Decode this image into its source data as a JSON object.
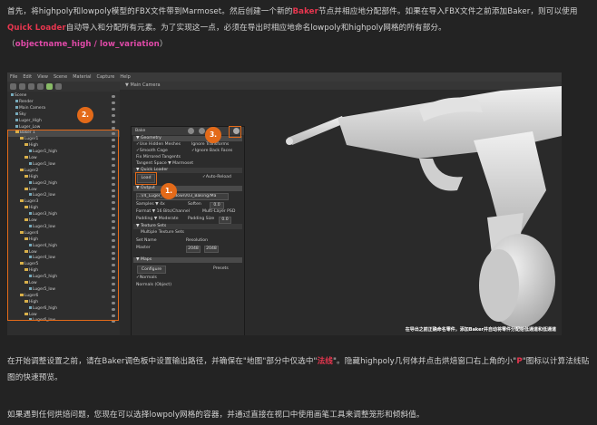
{
  "para1": {
    "t1": "首先，将highpoly和lowpoly模型的FBX文件带到Marmoset。然后创建一个新的",
    "baker": "Baker",
    "t2": "节点并相应地分配部件。如果在导入FBX文件之前添加Baker，则可以使用",
    "quick_loader": "Quick Loader",
    "t3": "自动导入和分配所有元素。为了实现这一点，必须在导出时相应地命名lowpoly和highpoly网格的所有部分。",
    "paren_open": "（",
    "naming": "objectname_high / low_variation",
    "paren_close": "）"
  },
  "screenshot": {
    "menu": [
      "File",
      "Edit",
      "View",
      "Scene",
      "Material",
      "Capture",
      "Help"
    ],
    "viewport_title": "Main Camera",
    "caption": "在导出之前正确命名零件，添加Baker并自动将零件分配给低通道和低通道",
    "badges": [
      "1.",
      "2.",
      "3."
    ],
    "tree": [
      {
        "label": "Scene",
        "indent": 0,
        "kind": "root"
      },
      {
        "label": "Render",
        "indent": 1,
        "kind": "obj"
      },
      {
        "label": "Main Camera",
        "indent": 1,
        "kind": "obj"
      },
      {
        "label": "Sky",
        "indent": 1,
        "kind": "obj"
      },
      {
        "label": "Luger_High",
        "indent": 1,
        "kind": "obj"
      },
      {
        "label": "Luger_Low",
        "indent": 1,
        "kind": "obj"
      },
      {
        "label": "Baker 1",
        "indent": 1,
        "kind": "folder",
        "selected": true
      },
      {
        "label": "Luger1",
        "indent": 2,
        "kind": "folder"
      },
      {
        "label": "High",
        "indent": 3,
        "kind": "folder"
      },
      {
        "label": "Luger1_high",
        "indent": 4,
        "kind": "obj"
      },
      {
        "label": "Low",
        "indent": 3,
        "kind": "folder"
      },
      {
        "label": "Luger1_low",
        "indent": 4,
        "kind": "obj"
      },
      {
        "label": "Luger2",
        "indent": 2,
        "kind": "folder"
      },
      {
        "label": "High",
        "indent": 3,
        "kind": "folder"
      },
      {
        "label": "Luger2_high",
        "indent": 4,
        "kind": "obj"
      },
      {
        "label": "Low",
        "indent": 3,
        "kind": "folder"
      },
      {
        "label": "Luger2_low",
        "indent": 4,
        "kind": "obj"
      },
      {
        "label": "Luger3",
        "indent": 2,
        "kind": "folder"
      },
      {
        "label": "High",
        "indent": 3,
        "kind": "folder"
      },
      {
        "label": "Luger3_high",
        "indent": 4,
        "kind": "obj"
      },
      {
        "label": "Low",
        "indent": 3,
        "kind": "folder"
      },
      {
        "label": "Luger3_low",
        "indent": 4,
        "kind": "obj"
      },
      {
        "label": "Luger4",
        "indent": 2,
        "kind": "folder"
      },
      {
        "label": "High",
        "indent": 3,
        "kind": "folder"
      },
      {
        "label": "Luger4_high",
        "indent": 4,
        "kind": "obj"
      },
      {
        "label": "Low",
        "indent": 3,
        "kind": "folder"
      },
      {
        "label": "Luger4_low",
        "indent": 4,
        "kind": "obj"
      },
      {
        "label": "Luger5",
        "indent": 2,
        "kind": "folder"
      },
      {
        "label": "High",
        "indent": 3,
        "kind": "folder"
      },
      {
        "label": "Luger5_high",
        "indent": 4,
        "kind": "obj"
      },
      {
        "label": "Low",
        "indent": 3,
        "kind": "folder"
      },
      {
        "label": "Luger5_low",
        "indent": 4,
        "kind": "obj"
      },
      {
        "label": "Luger6",
        "indent": 2,
        "kind": "folder"
      },
      {
        "label": "High",
        "indent": 3,
        "kind": "folder"
      },
      {
        "label": "Luger6_high",
        "indent": 4,
        "kind": "obj"
      },
      {
        "label": "Low",
        "indent": 3,
        "kind": "folder"
      },
      {
        "label": "Luger6_low",
        "indent": 4,
        "kind": "obj"
      }
    ],
    "panel": {
      "title": "Bake",
      "geometry": "Geometry",
      "use_hidden": "✓Use Hidden Meshes",
      "ignore_transforms": "Ignore Transforms",
      "smooth_cage": "✓Smooth Cage",
      "ignore_back": "✓Ignore Back Faces",
      "fix_mirrored": "Fix Mirrored Tangents",
      "tangent_space": "Tangent Space ▼ Marmoset",
      "quick_loader": "Quick Loader",
      "load": "Load",
      "auto_reload": "✓Auto-Reload",
      "output": "Output",
      "path": "...\\/4_Luger_Breakdown/03_Baking/Ma",
      "samples": "Samples ▼ 4x",
      "soften": "Soften",
      "soften_val": "0.0",
      "format": "Format ▼ 16 Bits/Channel",
      "multilayer": "Multi-Layer PSD",
      "padding": "Padding ▼ Moderate",
      "padding_size": "Padding Size",
      "padding_size_val": "0.0",
      "texture_sets": "Texture Sets",
      "multiple_sets": "Multiple Texture Sets",
      "set_name": "Set Name",
      "resolution": "Resolution",
      "master": "Master",
      "res_w": "2048",
      "res_h": "2048",
      "maps": "Maps",
      "configure": "Configure",
      "presets": "Presets",
      "normals": "✓Normals",
      "normals_obj": "Normals (Object)"
    }
  },
  "para2": {
    "t1": "在开始调整设置之前，请在Baker调色板中设置输出路径，并确保在\"地图\"部分中仅选中\"",
    "normal": "法线",
    "t2": "\"。隐藏highpoly几何体并点击烘焙窗口右上角的小\"",
    "p": "P",
    "t3": "\"图标以计算法线贴图的快速预览。"
  },
  "para3": {
    "t1": "如果遇到任何烘焙问题，您现在可以选择lowpoly网格的容器，并通过直接在视口中使用画笔工具来调整笼形和倾斜值。"
  }
}
